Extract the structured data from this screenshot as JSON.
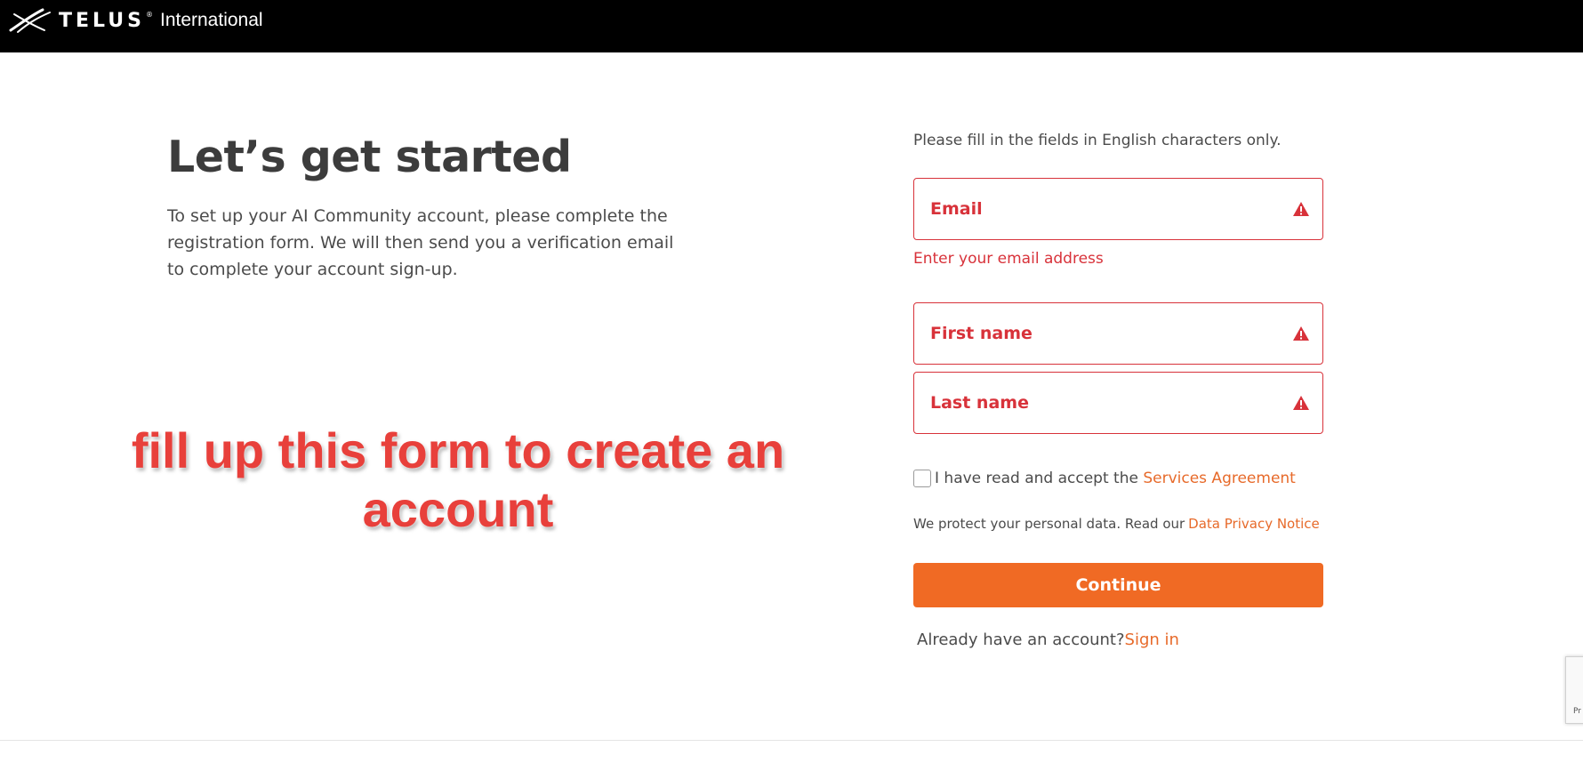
{
  "header": {
    "brand": "TELUS",
    "brand_mark": "®",
    "brand_sub": "International"
  },
  "hero": {
    "title": "Let’s get started",
    "description": "To set up your AI Community account, please complete the registration form. We will then send you a verification email to complete your account sign-up."
  },
  "annotation": {
    "text": "fill up this form to create an account",
    "color": "#e8403b"
  },
  "form": {
    "note": "Please fill in the fields in English characters only.",
    "email": {
      "placeholder": "Email",
      "value": "",
      "error": "Enter your email address"
    },
    "first_name": {
      "placeholder": "First name",
      "value": ""
    },
    "last_name": {
      "placeholder": "Last name",
      "value": ""
    },
    "agreement": {
      "text": "I have read and accept the ",
      "link": "Services Agreement",
      "checked": false
    },
    "privacy": {
      "text": "We protect your personal data. Read our",
      "link": "Data Privacy Notice"
    },
    "continue_label": "Continue",
    "signin": {
      "text": "Already have an account?",
      "link": "Sign in"
    },
    "error_icon": "warning-triangle-icon"
  },
  "recaptcha": {
    "text": "Pr"
  },
  "colors": {
    "header_bg": "#000000",
    "error": "#d8323a",
    "accent": "#f06a24",
    "link": "#e76a2a"
  }
}
